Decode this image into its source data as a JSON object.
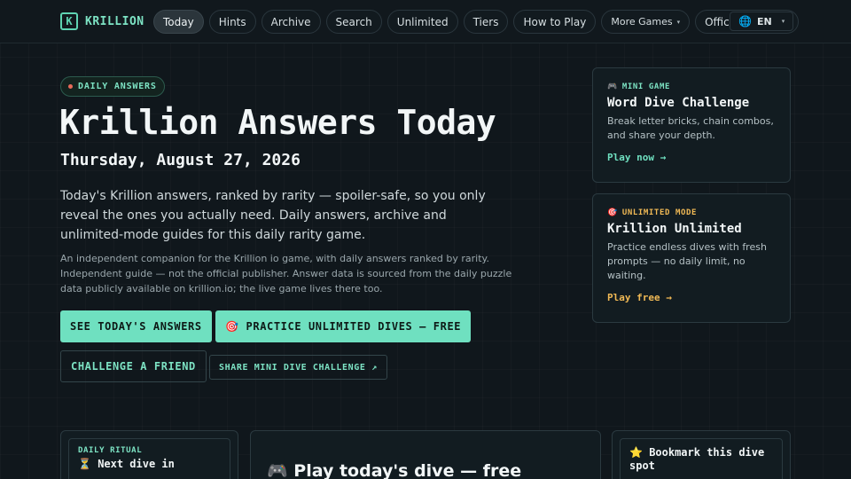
{
  "header": {
    "brand_logo": "K",
    "brand_name": "KRILLION",
    "nav": [
      {
        "label": "Today",
        "active": true
      },
      {
        "label": "Hints"
      },
      {
        "label": "Archive"
      },
      {
        "label": "Search"
      },
      {
        "label": "Unlimited"
      },
      {
        "label": "Tiers"
      },
      {
        "label": "How to Play"
      },
      {
        "label": "More Games"
      },
      {
        "label": "Official Game ↗"
      }
    ],
    "more_caret": "▾",
    "language": "EN",
    "language_caret": "▾"
  },
  "hero": {
    "badge": "DAILY ANSWERS",
    "title": "Krillion Answers Today",
    "date": "Thursday, August 27, 2026",
    "lead": "Today's Krillion answers, ranked by rarity — spoiler-safe, so you only reveal the ones you actually need. Daily answers, archive and unlimited-mode guides for this daily rarity game.",
    "note": "An independent companion for the Krillion io game, with daily answers ranked by rarity. Independent guide — not the official publisher. Answer data is sourced from the daily puzzle data publicly available on krillion.io; the live game lives there too.",
    "buttons": {
      "see_answers": "SEE TODAY'S ANSWERS",
      "practice_icon": "🎯",
      "practice": "PRACTICE UNLIMITED DIVES — FREE",
      "challenge": "CHALLENGE A FRIEND",
      "share": "SHARE MINI DIVE CHALLENGE ↗"
    }
  },
  "cards": {
    "mini": {
      "icon": "🎮",
      "tag": "MINI GAME",
      "title": "Word Dive Challenge",
      "desc": "Break letter bricks, chain combos, and share your depth.",
      "link": "Play now →"
    },
    "unlimited": {
      "icon": "🎯",
      "tag": "UNLIMITED MODE",
      "title": "Krillion Unlimited",
      "desc": "Practice endless dives with fresh prompts — no daily limit, no waiting.",
      "link": "Play free →"
    }
  },
  "bottom": {
    "ritual_tag": "DAILY RITUAL",
    "ritual_icon": "⏳",
    "ritual_line": "Next dive in",
    "play_icon": "🎮",
    "play_title": "Play today's dive — free",
    "bookmark_icon": "⭐",
    "bookmark": "Bookmark this dive spot"
  },
  "colors": {
    "accent": "#6fe0c0",
    "warn": "#f0b955",
    "background": "#10171c"
  }
}
